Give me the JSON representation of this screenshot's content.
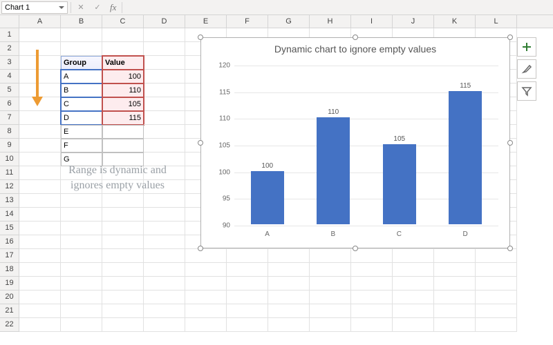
{
  "formula_bar": {
    "name_box": "Chart 1",
    "cancel_glyph": "✕",
    "confirm_glyph": "✓",
    "fx_label": "fx"
  },
  "columns": [
    "A",
    "B",
    "C",
    "D",
    "E",
    "F",
    "G",
    "H",
    "I",
    "J",
    "K",
    "L"
  ],
  "row_count": 22,
  "data_table": {
    "header": {
      "group": "Group",
      "value": "Value"
    },
    "rows": [
      {
        "group": "A",
        "value": "100"
      },
      {
        "group": "B",
        "value": "110"
      },
      {
        "group": "C",
        "value": "105"
      },
      {
        "group": "D",
        "value": "115"
      },
      {
        "group": "E",
        "value": ""
      },
      {
        "group": "F",
        "value": ""
      },
      {
        "group": "G",
        "value": ""
      }
    ]
  },
  "note": "Range is dynamic and ignores empty values",
  "chart_data": {
    "type": "bar",
    "title": "Dynamic chart to ignore empty values",
    "categories": [
      "A",
      "B",
      "C",
      "D"
    ],
    "values": [
      100,
      110,
      105,
      115
    ],
    "ylabel": "",
    "xlabel": "",
    "ylim": [
      90,
      120
    ],
    "yticks": [
      90,
      95,
      100,
      105,
      110,
      115,
      120
    ],
    "data_labels": [
      "100",
      "110",
      "105",
      "115"
    ],
    "bar_color": "#4472c4"
  },
  "side_buttons": {
    "add": "chart-elements",
    "style": "chart-styles",
    "filter": "chart-filters"
  }
}
